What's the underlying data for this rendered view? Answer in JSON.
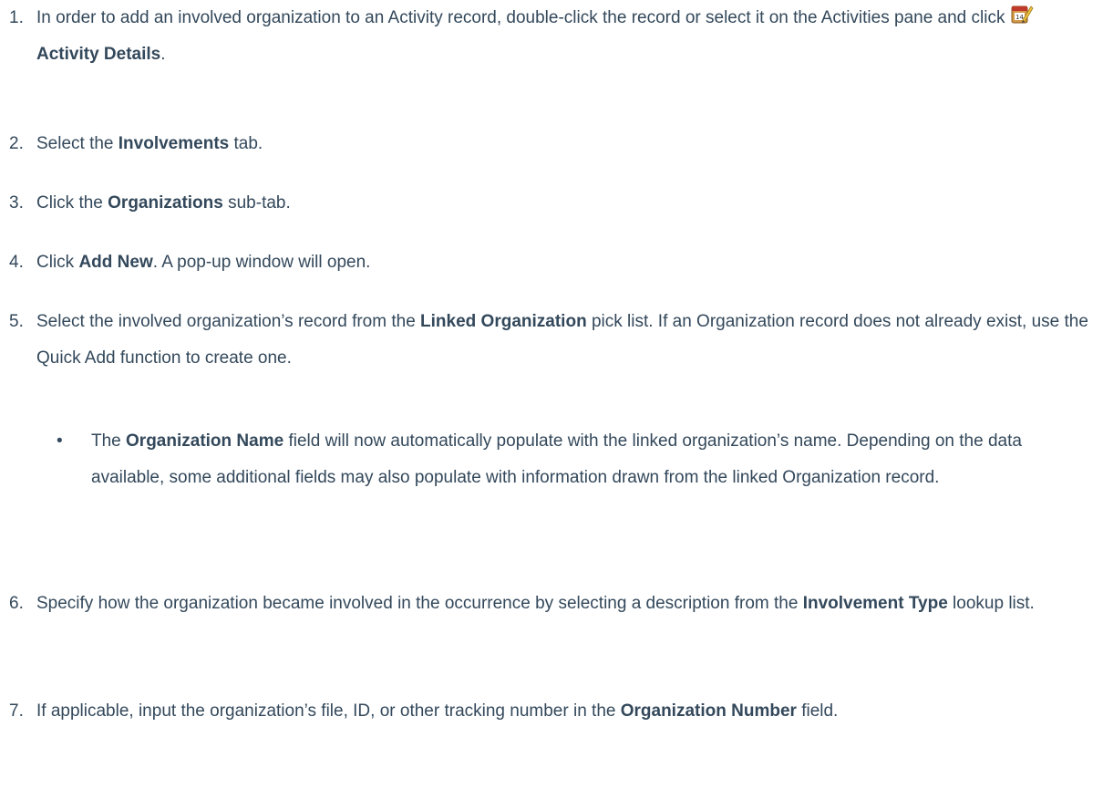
{
  "steps": [
    {
      "num": "1.",
      "parts": [
        {
          "t": "In order to add an involved organization to an Activity record, double-click the record or select it on the Activities pane and click "
        },
        {
          "icon": "activity-details-icon"
        },
        {
          "b": "Activity Details"
        },
        {
          "t": "."
        }
      ]
    },
    {
      "num": "2.",
      "parts": [
        {
          "t": "Select the "
        },
        {
          "b": "Involvements"
        },
        {
          "t": " tab."
        }
      ]
    },
    {
      "num": "3.",
      "parts": [
        {
          "t": "Click the "
        },
        {
          "b": "Organizations"
        },
        {
          "t": " sub-tab."
        }
      ]
    },
    {
      "num": "4.",
      "parts": [
        {
          "t": "Click "
        },
        {
          "b": "Add New"
        },
        {
          "t": ". A pop-up window will open."
        }
      ]
    },
    {
      "num": "5.",
      "parts": [
        {
          "t": "Select the involved organization’s record from the "
        },
        {
          "b": "Linked Organization"
        },
        {
          "t": " pick list. If an Organization record does not already exist, use the Quick Add function to create one."
        }
      ]
    },
    {
      "num": "6.",
      "parts": [
        {
          "t": "Specify how the organization became involved in the occurrence by selecting a description from the "
        },
        {
          "b": "Involvement Type"
        },
        {
          "t": " lookup list."
        }
      ]
    },
    {
      "num": "7.",
      "parts": [
        {
          "t": "If applicable, input the organization’s file, ID, or other tracking number in the "
        },
        {
          "b": "Organization Number"
        },
        {
          "t": " field."
        }
      ]
    }
  ],
  "bullet": {
    "symbol": "•",
    "parts": [
      {
        "t": "The "
      },
      {
        "b": "Organization Name"
      },
      {
        "t": " field will now automatically populate with the linked organization’s name. Depending on the data available, some additional fields may also populate with information drawn from the linked Organization record."
      }
    ]
  }
}
